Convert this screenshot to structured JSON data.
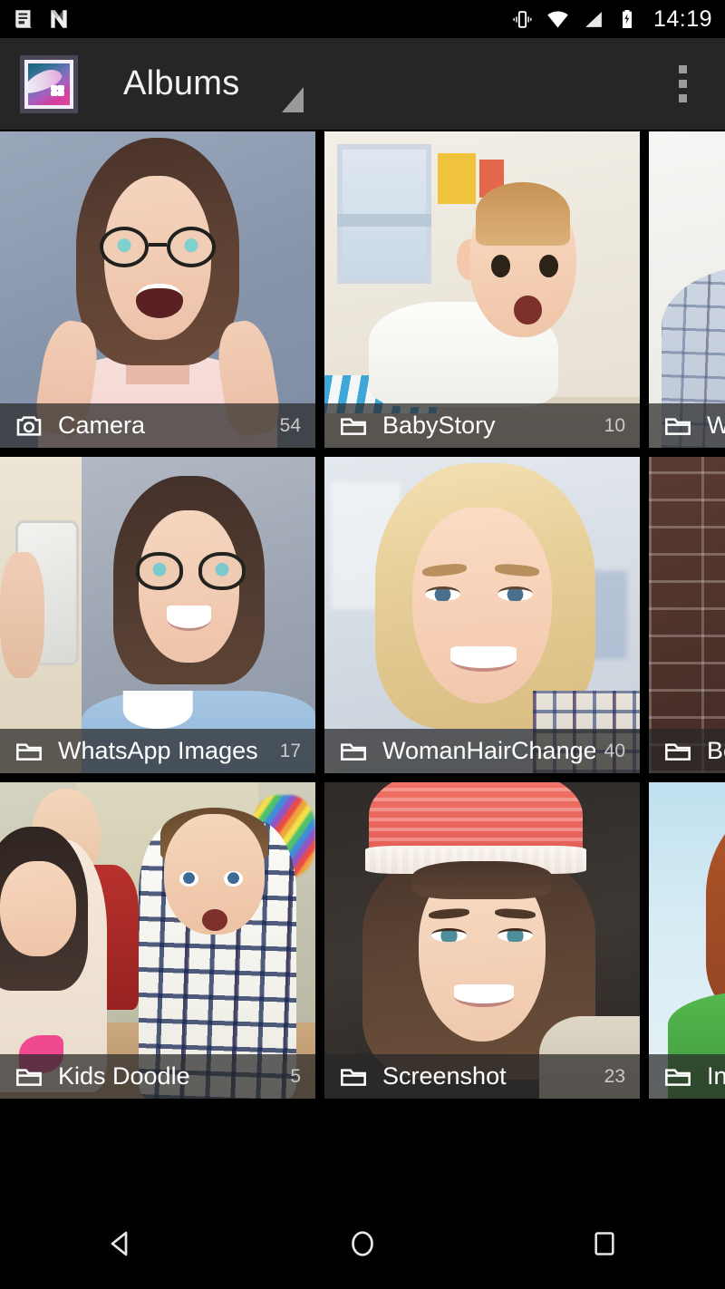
{
  "status_bar": {
    "left_icons": [
      "news-icon",
      "android-nougat-icon"
    ],
    "right_icons": [
      "vibrate-icon",
      "wifi-icon",
      "cellular-signal-icon",
      "battery-charging-icon"
    ],
    "time": "14:19"
  },
  "toolbar": {
    "app_icon": "gallery-app-icon",
    "title": "Albums",
    "dropdown_icon": "triangle-caret-icon",
    "overflow_icon": "overflow-menu-icon"
  },
  "colors": {
    "status_bar_bg": "#000000",
    "toolbar_bg": "#262626",
    "page_bg": "#000000",
    "label_overlay": "rgba(40,40,40,0.72)",
    "label_text": "#ffffff",
    "count_text": "#c9c9c9"
  },
  "albums": [
    {
      "name": "Camera",
      "count": "54",
      "icon": "camera-icon"
    },
    {
      "name": "BabyStory",
      "count": "10",
      "icon": "folder-icon"
    },
    {
      "name": "WhatsApp",
      "count": "",
      "icon": "folder-icon"
    },
    {
      "name": "WhatsApp Images",
      "count": "17",
      "icon": "folder-icon"
    },
    {
      "name": "WomanHairChanger",
      "count": "40",
      "icon": "folder-icon"
    },
    {
      "name": "Best",
      "count": "",
      "icon": "folder-icon"
    },
    {
      "name": "Kids Doodle",
      "count": "5",
      "icon": "folder-icon"
    },
    {
      "name": "Screenshot",
      "count": "23",
      "icon": "folder-icon"
    },
    {
      "name": "Instagram",
      "count": "",
      "icon": "folder-icon"
    }
  ],
  "nav_bar": {
    "back": "back-triangle-icon",
    "home": "home-circle-icon",
    "recents": "recents-square-icon"
  }
}
